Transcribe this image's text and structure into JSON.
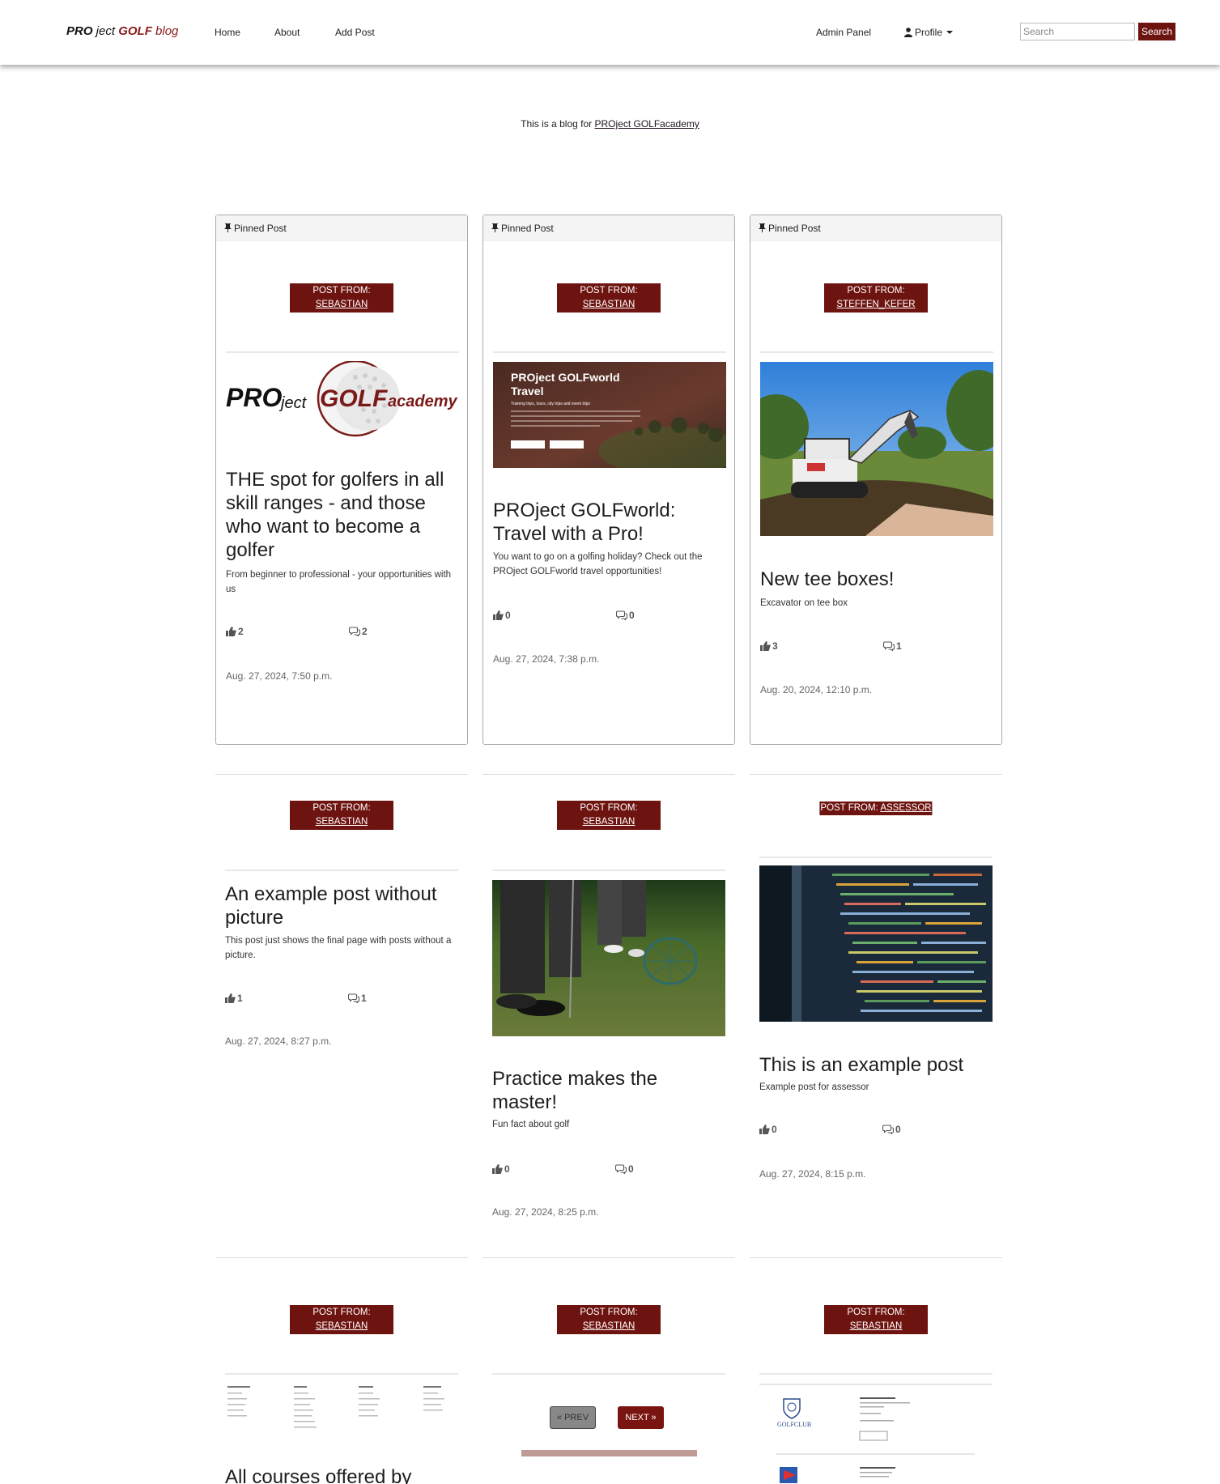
{
  "nav": {
    "brand_pro": "PRO",
    "brand_ject": " ject ",
    "brand_golf": "GOLF",
    "brand_blog": " blog",
    "home": "Home",
    "about": "About",
    "add_post": "Add Post",
    "admin_panel": "Admin Panel",
    "profile": "Profile",
    "search_placeholder": "Search",
    "search_button": "Search"
  },
  "intro": {
    "text": "This is a blog for ",
    "link": "PROject GOLFacademy"
  },
  "labels": {
    "pinned": "Pinned Post",
    "post_from": "POST FROM:",
    "prev": "« PREV",
    "next": "NEXT »"
  },
  "posts": [
    {
      "author": "SEBASTIAN",
      "title": "THE spot for golfers in all skill ranges - and those who want to become a golfer",
      "excerpt": "From beginner to professional - your opportunities with us",
      "likes": "2",
      "comments": "2",
      "date": "Aug. 27, 2024, 7:50 p.m.",
      "image": "project-golfacademy-logo",
      "logo_pro": "PRO",
      "logo_ject": "ject",
      "logo_golf": "GOLF",
      "logo_academy": "academy"
    },
    {
      "author": "SEBASTIAN",
      "title": "PROject GOLFworld: Travel with a Pro!",
      "excerpt": "You want to go on a golfing holiday? Check out the PROject GOLFworld travel opportunities!",
      "likes": "0",
      "comments": "0",
      "date": "Aug. 27, 2024, 7:38 p.m.",
      "image": "golfworld-travel-banner",
      "banner_title": "PROject GOLFworld Travel",
      "banner_sub": "Training trips, tours, city trips and event trips"
    },
    {
      "author": "STEFFEN_KEFER",
      "title": "New tee boxes!",
      "excerpt": "Excavator on tee box",
      "likes": "3",
      "comments": "1",
      "date": "Aug. 20, 2024, 12:10 p.m.",
      "image": "excavator-photo"
    },
    {
      "author": "SEBASTIAN",
      "title": "An example post without picture",
      "excerpt": "This post just shows the final page with posts without a picture.",
      "likes": "1",
      "comments": "1",
      "date": "Aug. 27, 2024, 8:27 p.m.",
      "image": ""
    },
    {
      "author": "SEBASTIAN",
      "title": "Practice makes the master!",
      "excerpt": "Fun fact about golf",
      "likes": "0",
      "comments": "0",
      "date": "Aug. 27, 2024, 8:25 p.m.",
      "image": "golf-practice-photo"
    },
    {
      "author": "ASSESSOR",
      "title": "This is an example post",
      "excerpt": "Example post for assessor",
      "likes": "0",
      "comments": "0",
      "date": "Aug. 27, 2024, 8:15 p.m.",
      "image": "code-screen-photo"
    },
    {
      "author": "SEBASTIAN",
      "title": "All courses offered by",
      "image": "courses-table"
    },
    {
      "author": "SEBASTIAN",
      "image": ""
    },
    {
      "author": "SEBASTIAN",
      "image": "golf-clubs-list",
      "club_name": "GOLFCLUB"
    }
  ],
  "colors": {
    "accent": "#6e1410",
    "brand_red": "#8b1a1a"
  }
}
